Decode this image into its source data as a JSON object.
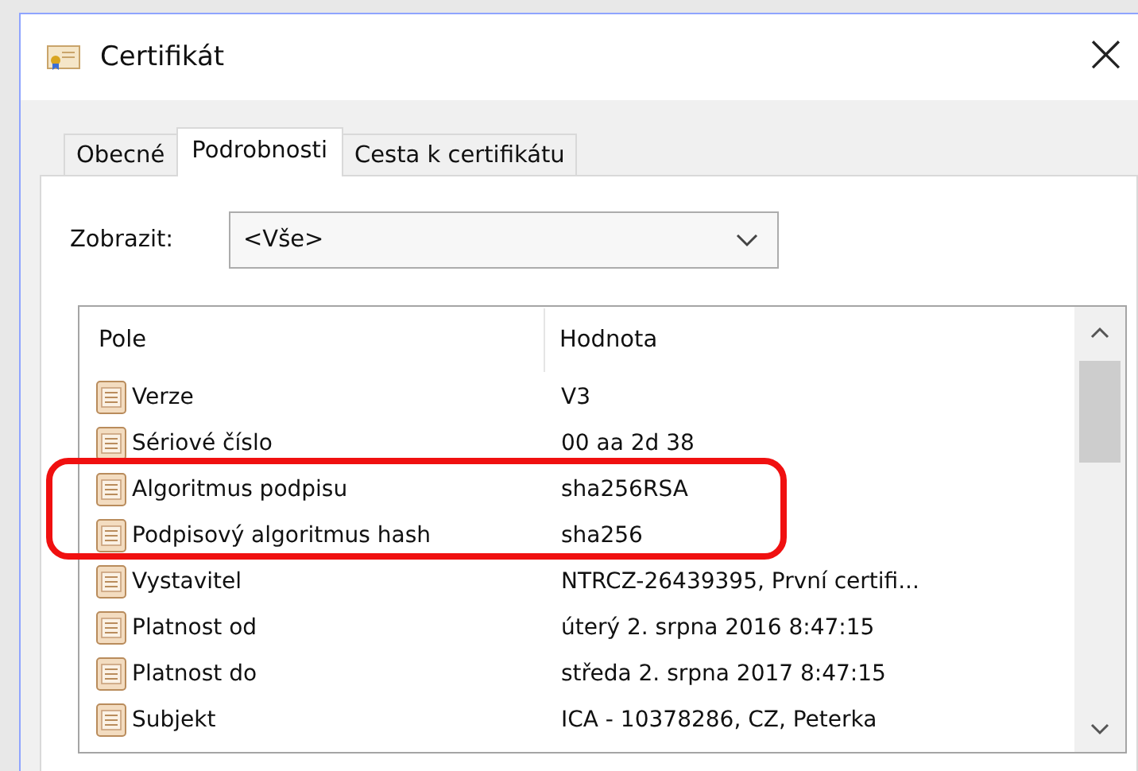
{
  "window": {
    "title": "Certifikát",
    "close": "×"
  },
  "tabs": [
    {
      "label": "Obecné",
      "selected": false
    },
    {
      "label": "Podrobnosti",
      "selected": true
    },
    {
      "label": "Cesta k certifikátu",
      "selected": false
    }
  ],
  "show": {
    "label": "Zobrazit:",
    "value": "<Vše>"
  },
  "table": {
    "columns": [
      "Pole",
      "Hodnota"
    ],
    "rows": [
      {
        "field": "Verze",
        "value": "V3",
        "highlighted": false
      },
      {
        "field": "Sériové číslo",
        "value": "00 aa 2d 38",
        "highlighted": false
      },
      {
        "field": "Algoritmus podpisu",
        "value": "sha256RSA",
        "highlighted": true
      },
      {
        "field": "Podpisový algoritmus hash",
        "value": "sha256",
        "highlighted": true
      },
      {
        "field": "Vystavitel",
        "value": "NTRCZ-26439395, První certifi...",
        "highlighted": false
      },
      {
        "field": "Platnost od",
        "value": "úterý 2. srpna 2016 8:47:15",
        "highlighted": false
      },
      {
        "field": "Platnost do",
        "value": "středa 2. srpna 2017 8:47:15",
        "highlighted": false
      },
      {
        "field": "Subjekt",
        "value": "ICA - 10378286, CZ, Peterka",
        "highlighted": false
      }
    ]
  }
}
